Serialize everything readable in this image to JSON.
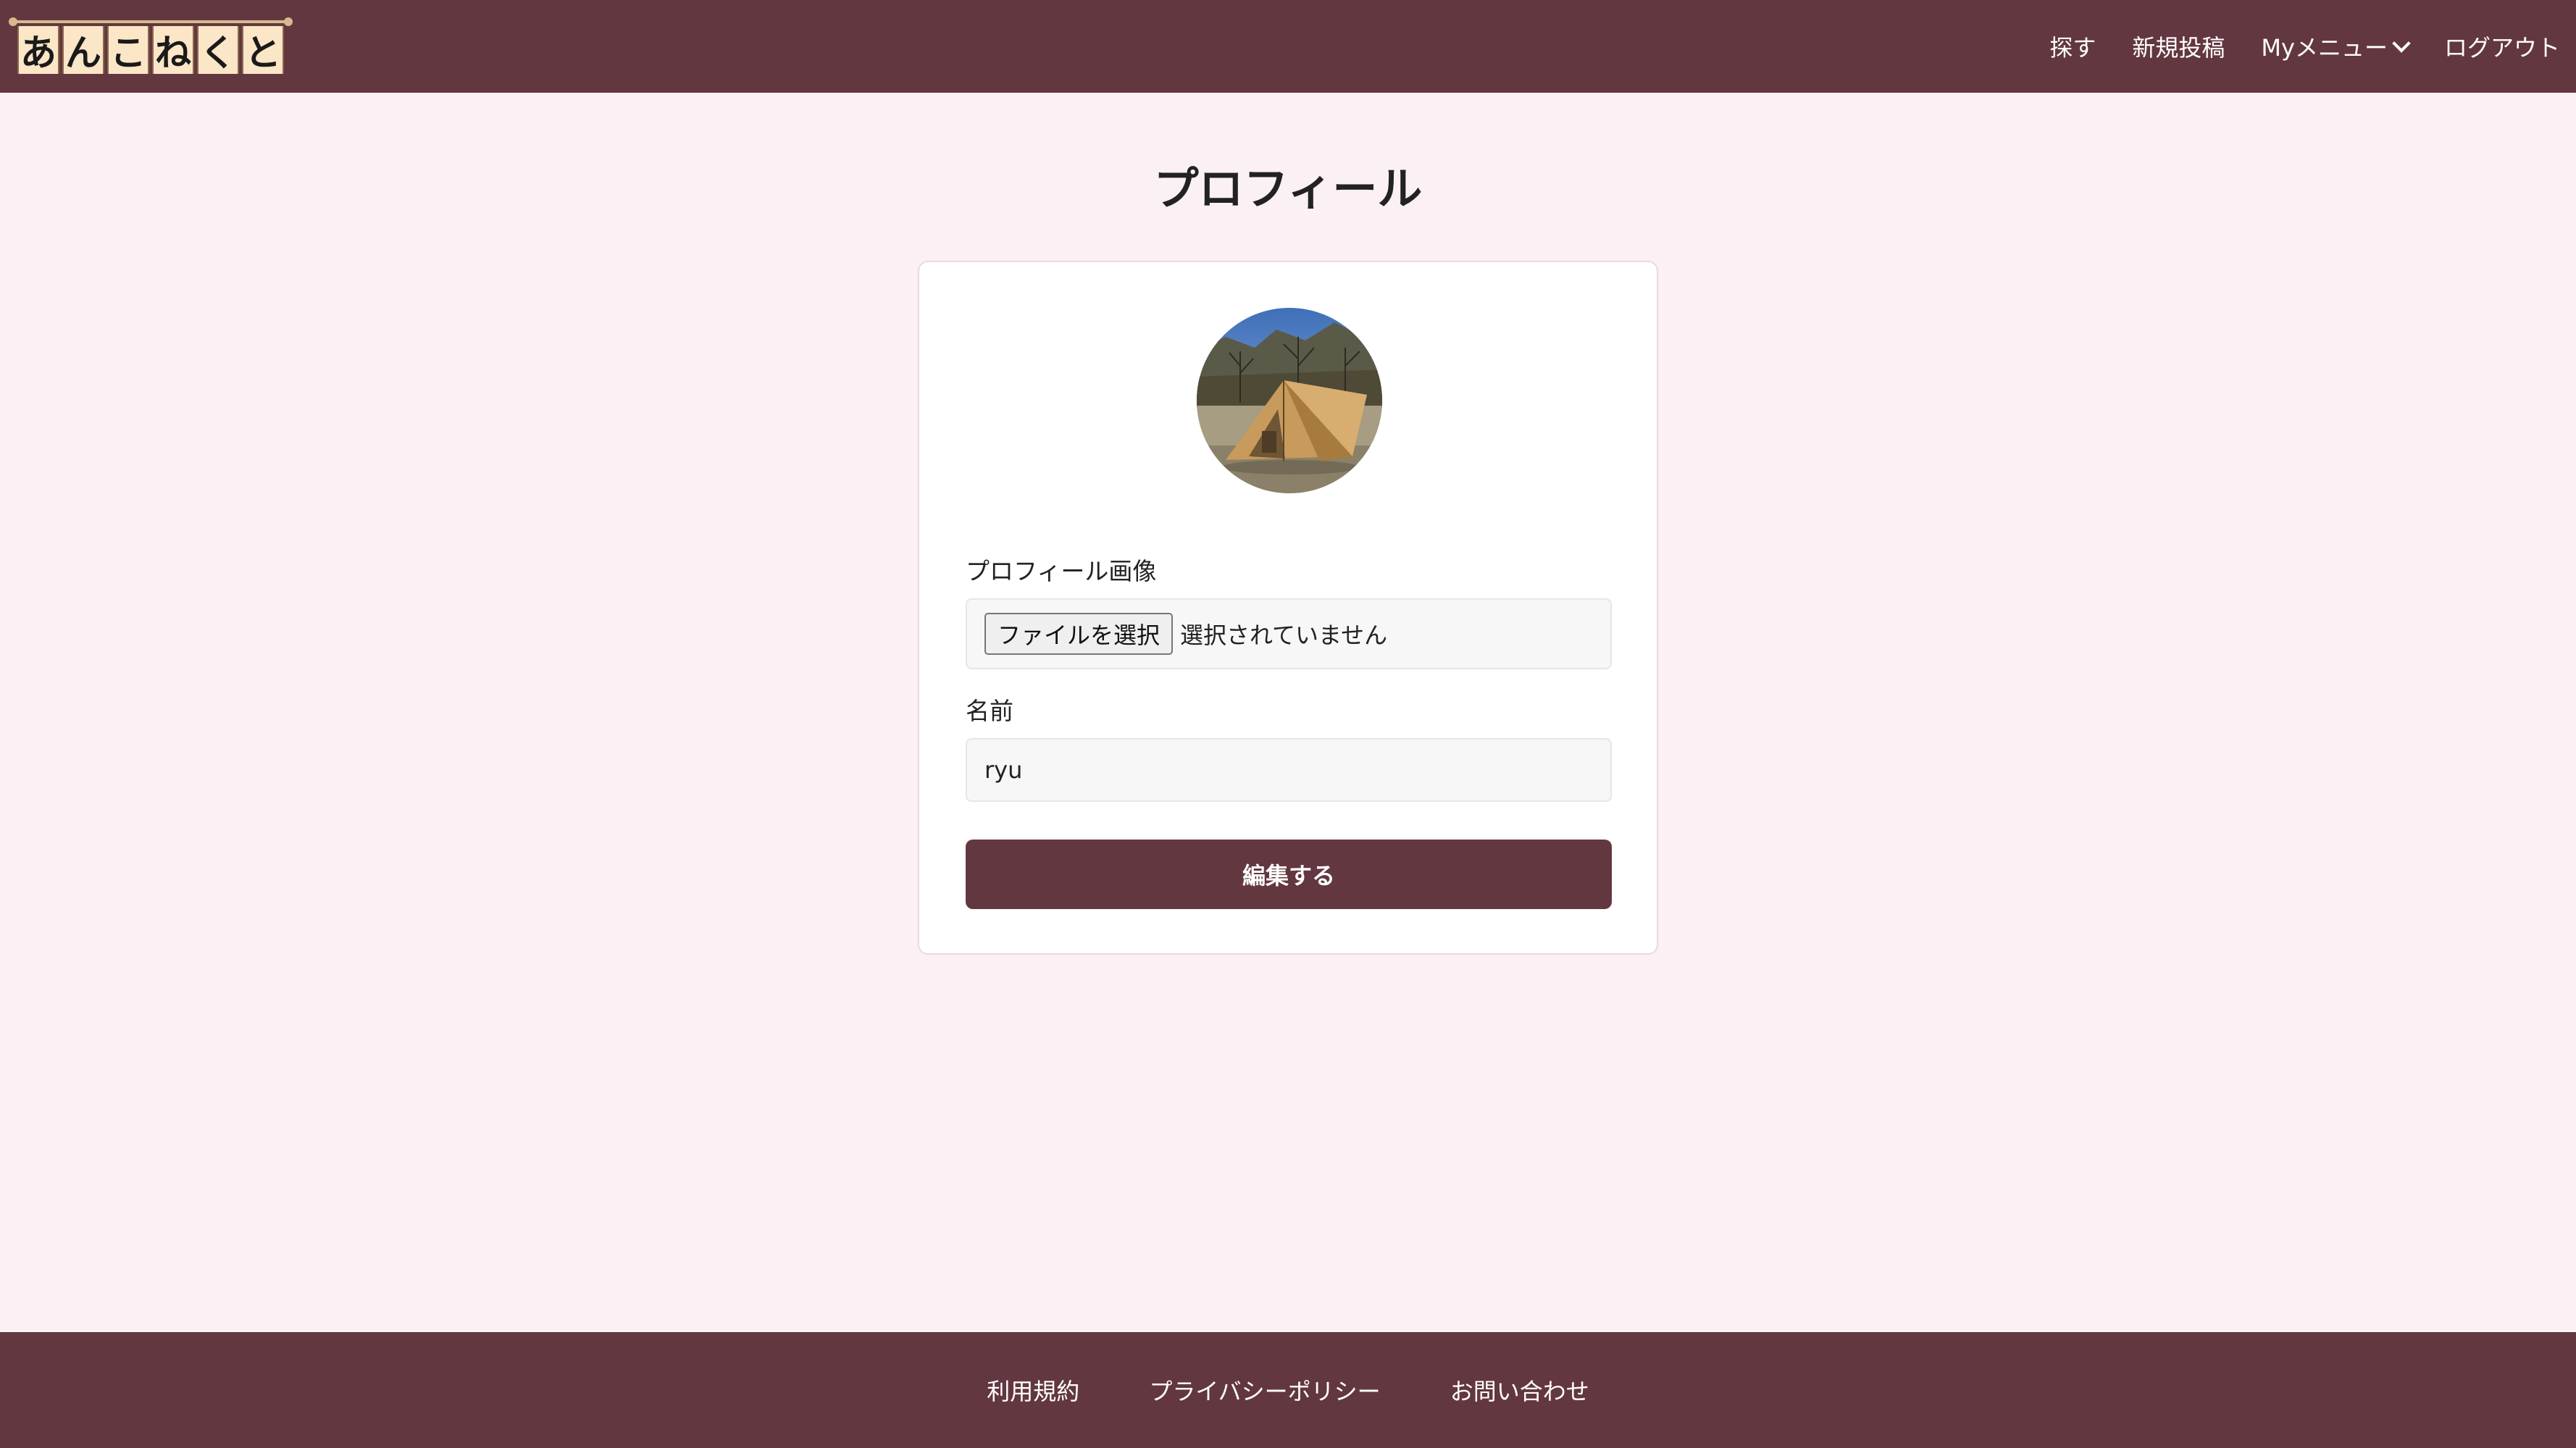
{
  "header": {
    "logo_chars": [
      "あ",
      "ん",
      "こ",
      "ね",
      "く",
      "と"
    ],
    "nav": {
      "search": "探す",
      "new_post": "新規投稿",
      "my_menu": "Myメニュー",
      "logout": "ログアウト"
    }
  },
  "main": {
    "title": "プロフィール",
    "avatar_icon": "tent-photo",
    "profile_image": {
      "label": "プロフィール画像",
      "button": "ファイルを選択",
      "status": "選択されていません"
    },
    "name": {
      "label": "名前",
      "value": "ryu"
    },
    "submit": "編集する"
  },
  "footer": {
    "links": [
      "利用規約",
      "プライバシーポリシー",
      "お問い合わせ"
    ]
  },
  "colors": {
    "brand": "#633740",
    "page_background": "#fbf0f4",
    "card_background": "#ffffff"
  }
}
